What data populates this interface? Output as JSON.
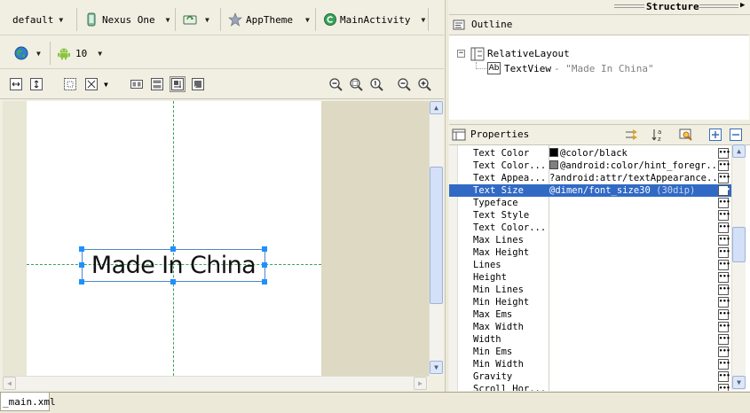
{
  "toolbar1": {
    "theme_config": "default",
    "device": "Nexus One",
    "app_theme": "AppTheme",
    "activity": "MainActivity"
  },
  "toolbar2": {
    "api_level": "10"
  },
  "canvas": {
    "textview_text": "Made In China"
  },
  "structure": {
    "title": "Structure"
  },
  "outline": {
    "title": "Outline",
    "root": "RelativeLayout",
    "child_label": "TextView",
    "child_detail": " - \"Made In China\""
  },
  "properties": {
    "title": "Properties",
    "rows": [
      {
        "name": "Text Color",
        "value": "@color/black",
        "swatch": "#000000"
      },
      {
        "name": "Text Color...",
        "value": "@android:color/hint_foregr...",
        "swatch": "#808080"
      },
      {
        "name": "Text Appea...",
        "value": "?android:attr/textAppearance..."
      },
      {
        "name": "Text Size",
        "value": "@dimen/font_size30",
        "value_hint": " (30dip)",
        "selected": true
      },
      {
        "name": "Typeface",
        "value": ""
      },
      {
        "name": "Text Style",
        "value": ""
      },
      {
        "name": "Text Color...",
        "value": ""
      },
      {
        "name": "Max Lines",
        "value": ""
      },
      {
        "name": "Max Height",
        "value": ""
      },
      {
        "name": "Lines",
        "value": ""
      },
      {
        "name": "Height",
        "value": ""
      },
      {
        "name": "Min Lines",
        "value": ""
      },
      {
        "name": "Min Height",
        "value": ""
      },
      {
        "name": "Max Ems",
        "value": ""
      },
      {
        "name": "Max Width",
        "value": ""
      },
      {
        "name": "Width",
        "value": ""
      },
      {
        "name": "Min Ems",
        "value": ""
      },
      {
        "name": "Min Width",
        "value": ""
      },
      {
        "name": "Gravity",
        "value": ""
      },
      {
        "name": "Scroll Hor...",
        "value": ""
      }
    ]
  },
  "editor_tab": {
    "label": "_main.xml"
  },
  "colors": {
    "selection": "#316ac5",
    "guide": "#3aa35a",
    "handle": "#1e90ff"
  }
}
